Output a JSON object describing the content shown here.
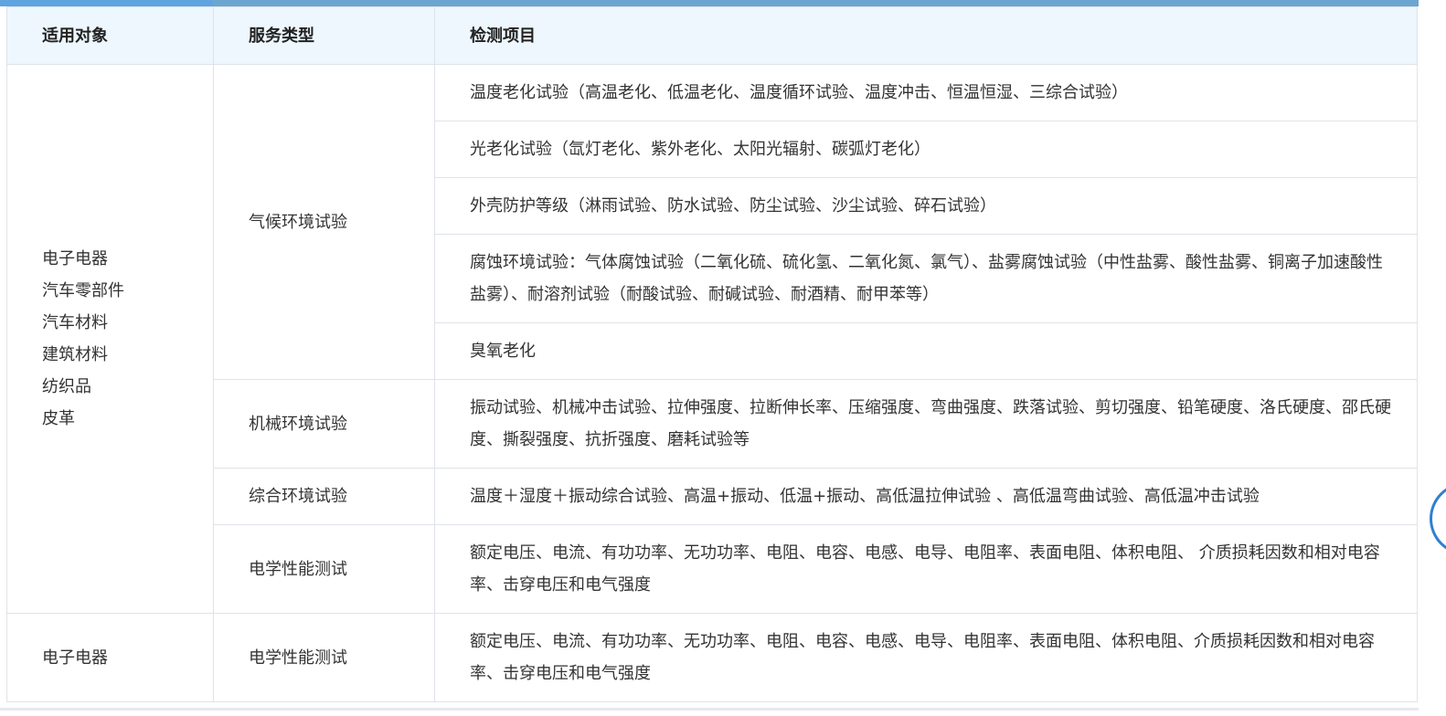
{
  "headers": {
    "object": "适用对象",
    "service": "服务类型",
    "items": "检测项目"
  },
  "groups": [
    {
      "objects": [
        "电子电器",
        "汽车零部件",
        "汽车材料",
        "建筑材料",
        "纺织品",
        "皮革"
      ],
      "services": [
        {
          "name": "气候环境试验",
          "items": [
            "温度老化试验（高温老化、低温老化、温度循环试验、温度冲击、恒温恒湿、三综合试验）",
            "光老化试验（氙灯老化、紫外老化、太阳光辐射、碳弧灯老化）",
            "外壳防护等级（淋雨试验、防水试验、防尘试验、沙尘试验、碎石试验）",
            "腐蚀环境试验：气体腐蚀试验（二氧化硫、硫化氢、二氧化氮、氯气）、盐雾腐蚀试验（中性盐雾、酸性盐雾、铜离子加速酸性盐雾）、耐溶剂试验（耐酸试验、耐碱试验、耐酒精、耐甲苯等）",
            "臭氧老化"
          ]
        },
        {
          "name": "机械环境试验",
          "items": [
            "振动试验、机械冲击试验、拉伸强度、拉断伸长率、压缩强度、弯曲强度、跌落试验、剪切强度、铅笔硬度、洛氏硬度、邵氏硬度、撕裂强度、抗折强度、磨耗试验等"
          ]
        },
        {
          "name": "综合环境试验",
          "items": [
            "温度＋湿度＋振动综合试验、高温+振动、低温+振动、高低温拉伸试验 、高低温弯曲试验、高低温冲击试验"
          ]
        },
        {
          "name": "电学性能测试",
          "items": [
            "额定电压、电流、有功功率、无功功率、电阻、电容、电感、电导、电阻率、表面电阻、体积电阻、 介质损耗因数和相对电容率、击穿电压和电气强度"
          ]
        }
      ]
    },
    {
      "objects": [
        "电子电器"
      ],
      "services": [
        {
          "name": "电学性能测试",
          "items": [
            "额定电压、电流、有功功率、无功功率、电阻、电容、电感、电导、电阻率、表面电阻、体积电阻、介质损耗因数和相对电容率、击穿电压和电气强度"
          ]
        }
      ]
    }
  ],
  "colors": {
    "header_bg": "#edf7fd",
    "top_bar": "#6aa6cf",
    "border": "#dfe3e8",
    "text": "#333333",
    "edge_widget": "#2f7fd1"
  },
  "icons": {
    "edge_widget": "floating-edge-button-icon"
  }
}
